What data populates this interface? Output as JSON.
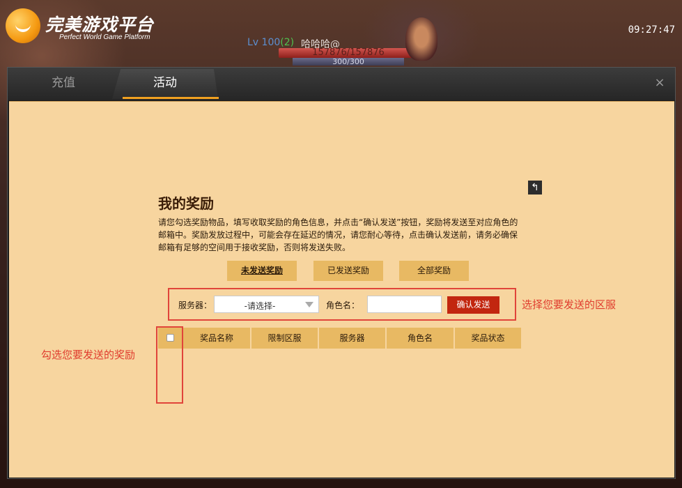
{
  "logo": {
    "name_cn": "完美游戏平台",
    "name_en": "Perfect World Game Platform"
  },
  "hud": {
    "level": "Lv 100",
    "level_bonus": "(2)",
    "player_name": "哈哈哈@",
    "hp": "157876/157876",
    "mp": "300/300"
  },
  "clock": "09:27:47",
  "dialog": {
    "tabs": [
      {
        "label": "充值"
      },
      {
        "label": "活动"
      }
    ],
    "close_label": "×",
    "back_label": "↰",
    "title": "我的奖励",
    "description": "请您勾选奖励物品，填写收取奖励的角色信息，并点击“确认发送”按钮，奖励将发送至对应角色的邮箱中。奖励发放过程中，可能会存在延迟的情况，请您耐心等待，点击确认发送前，请务必确保邮箱有足够的空间用于接收奖励，否则将发送失败。",
    "filters": {
      "unsent": "未发送奖励",
      "sent": "已发送奖励",
      "all": "全部奖励"
    },
    "server_label": "服务器：",
    "server_placeholder": "-请选择-",
    "role_label": "角色名：",
    "role_value": "",
    "confirm_label": "确认发送",
    "table_headers": [
      "奖品名称",
      "限制区服",
      "服务器",
      "角色名",
      "奖品状态"
    ],
    "hint_server": "选择您要发送的区服",
    "hint_check": "勾选您要发送的奖励"
  }
}
